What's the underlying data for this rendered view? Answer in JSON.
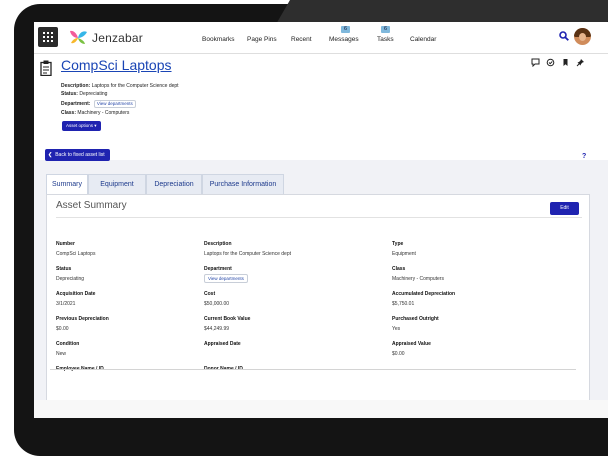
{
  "nav": {
    "brand": "Jenzabar",
    "links": [
      {
        "label": "Bookmarks"
      },
      {
        "label": "Page Pins"
      },
      {
        "label": "Recent"
      },
      {
        "label": "Messages",
        "badge": "6"
      },
      {
        "label": "Tasks",
        "badge": "6"
      },
      {
        "label": "Calendar"
      }
    ],
    "icons": {
      "menu": "grid-icon",
      "search": "search-icon",
      "avatar": "user-avatar"
    }
  },
  "header": {
    "title": "CompSci Laptops",
    "description_label": "Description:",
    "description_value": "Laptops for the Computer Science dept",
    "status_label": "Status:",
    "status_value": "Depreciating",
    "department_label": "Department:",
    "department_value": "View departments",
    "class_label": "Class:",
    "class_value": "Machinery - Computers",
    "asset_options": "Asset options ▾",
    "icons": [
      "comment-icon",
      "history-icon",
      "bookmark-icon",
      "pin-icon"
    ]
  },
  "back_button": "Back to fixed asset list",
  "help_symbol": "?",
  "tabs": [
    {
      "label": "Summary",
      "active": true
    },
    {
      "label": "Equipment",
      "active": false
    },
    {
      "label": "Depreciation",
      "active": false
    },
    {
      "label": "Purchase Information",
      "active": false
    }
  ],
  "summary": {
    "title": "Asset Summary",
    "edit_label": "Edit",
    "fields": [
      {
        "label": "Number",
        "value": "CompSci Laptops"
      },
      {
        "label": "Description",
        "value": "Laptops for the Computer Science dept"
      },
      {
        "label": "Type",
        "value": "Equipment"
      },
      {
        "label": "Status",
        "value": "Depreciating"
      },
      {
        "label": "Department",
        "value": "View departments"
      },
      {
        "label": "Class",
        "value": "Machinery - Computers"
      },
      {
        "label": "Acquisition Date",
        "value": "3/1/2021"
      },
      {
        "label": "Cost",
        "value": "$50,000.00"
      },
      {
        "label": "Accumulated Depreciation",
        "value": "$5,750.01"
      },
      {
        "label": "Previous Depreciation",
        "value": "$0.00"
      },
      {
        "label": "Current Book Value",
        "value": "$44,249.99"
      },
      {
        "label": "Purchased Outright",
        "value": "Yes"
      },
      {
        "label": "Condition",
        "value": "New"
      },
      {
        "label": "Appraised Date",
        "value": ""
      },
      {
        "label": "Appraised Value",
        "value": "$0.00"
      },
      {
        "label": "Employee Name / ID",
        "value": ""
      },
      {
        "label": "Donor Name / ID",
        "value": ""
      }
    ]
  },
  "colors": {
    "accent": "#1f23b0",
    "link": "#1a45b5",
    "badge": "#7fb8dc"
  }
}
